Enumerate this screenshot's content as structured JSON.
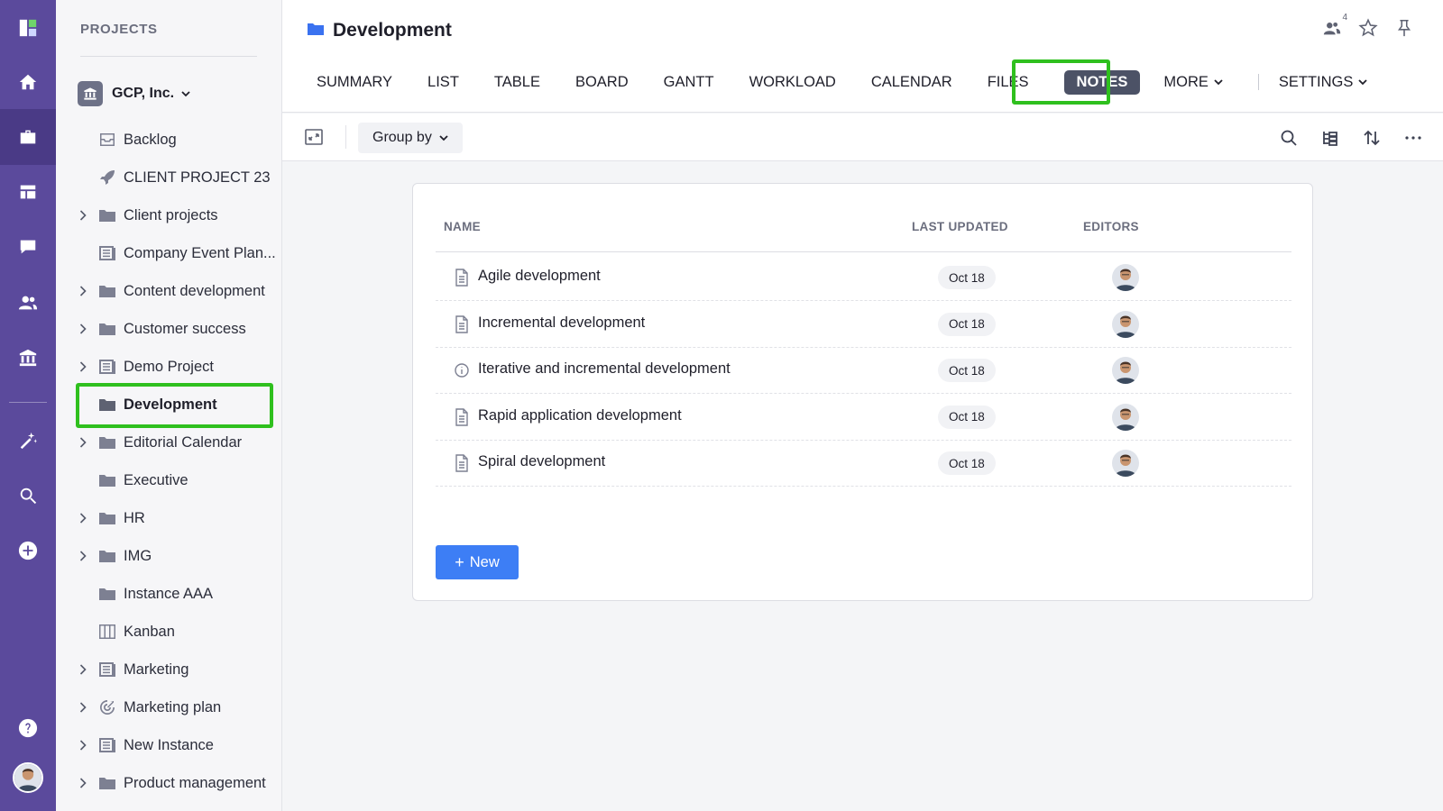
{
  "sidebar": {
    "header": "PROJECTS",
    "org": "GCP, Inc.",
    "items": [
      {
        "label": "Backlog",
        "icon": "inbox-icon",
        "expandable": false
      },
      {
        "label": "CLIENT PROJECT 23",
        "icon": "rocket-icon",
        "expandable": false
      },
      {
        "label": "Client projects",
        "icon": "folder-icon",
        "expandable": true
      },
      {
        "label": "Company Event Plan...",
        "icon": "list-icon",
        "expandable": false
      },
      {
        "label": "Content development",
        "icon": "folder-icon",
        "expandable": true
      },
      {
        "label": "Customer success",
        "icon": "folder-icon",
        "expandable": true
      },
      {
        "label": "Demo Project",
        "icon": "list-icon",
        "expandable": true
      },
      {
        "label": "Development",
        "icon": "folder-icon",
        "expandable": false,
        "selected": true
      },
      {
        "label": "Editorial Calendar",
        "icon": "folder-icon",
        "expandable": true
      },
      {
        "label": "Executive",
        "icon": "folder-icon",
        "expandable": false
      },
      {
        "label": "HR",
        "icon": "folder-icon",
        "expandable": true
      },
      {
        "label": "IMG",
        "icon": "folder-icon",
        "expandable": true
      },
      {
        "label": "Instance AAA",
        "icon": "folder-icon",
        "expandable": false
      },
      {
        "label": "Kanban",
        "icon": "board-icon",
        "expandable": false
      },
      {
        "label": "Marketing",
        "icon": "list-icon",
        "expandable": true
      },
      {
        "label": "Marketing plan",
        "icon": "target-icon",
        "expandable": true
      },
      {
        "label": "New Instance",
        "icon": "list-icon",
        "expandable": true
      },
      {
        "label": "Product management",
        "icon": "folder-icon",
        "expandable": true
      }
    ]
  },
  "header": {
    "title": "Development",
    "shared_count": "4",
    "tabs": [
      {
        "label": "SUMMARY"
      },
      {
        "label": "LIST"
      },
      {
        "label": "TABLE"
      },
      {
        "label": "BOARD"
      },
      {
        "label": "GANTT"
      },
      {
        "label": "WORKLOAD"
      },
      {
        "label": "CALENDAR"
      },
      {
        "label": "FILES"
      },
      {
        "label": "NOTES",
        "active": true
      },
      {
        "label": "MORE",
        "dropdown": true
      },
      {
        "label": "SETTINGS",
        "dropdown": true
      }
    ]
  },
  "toolbar": {
    "group_by": "Group by"
  },
  "notes_table": {
    "columns": {
      "name": "NAME",
      "last_updated": "LAST UPDATED",
      "editors": "EDITORS"
    },
    "rows": [
      {
        "name": "Agile development",
        "icon": "document-icon",
        "date": "Oct 18"
      },
      {
        "name": "Incremental development",
        "icon": "document-icon",
        "date": "Oct 18"
      },
      {
        "name": "Iterative and incremental development",
        "icon": "info-icon",
        "date": "Oct 18"
      },
      {
        "name": "Rapid application development",
        "icon": "document-icon",
        "date": "Oct 18"
      },
      {
        "name": "Spiral development",
        "icon": "document-icon",
        "date": "Oct 18"
      }
    ],
    "new_button": "New"
  },
  "colors": {
    "rail": "#5b4a9c",
    "accent": "#3d7ef5",
    "highlight": "#2fc01e",
    "active_tab": "#4c5266"
  }
}
